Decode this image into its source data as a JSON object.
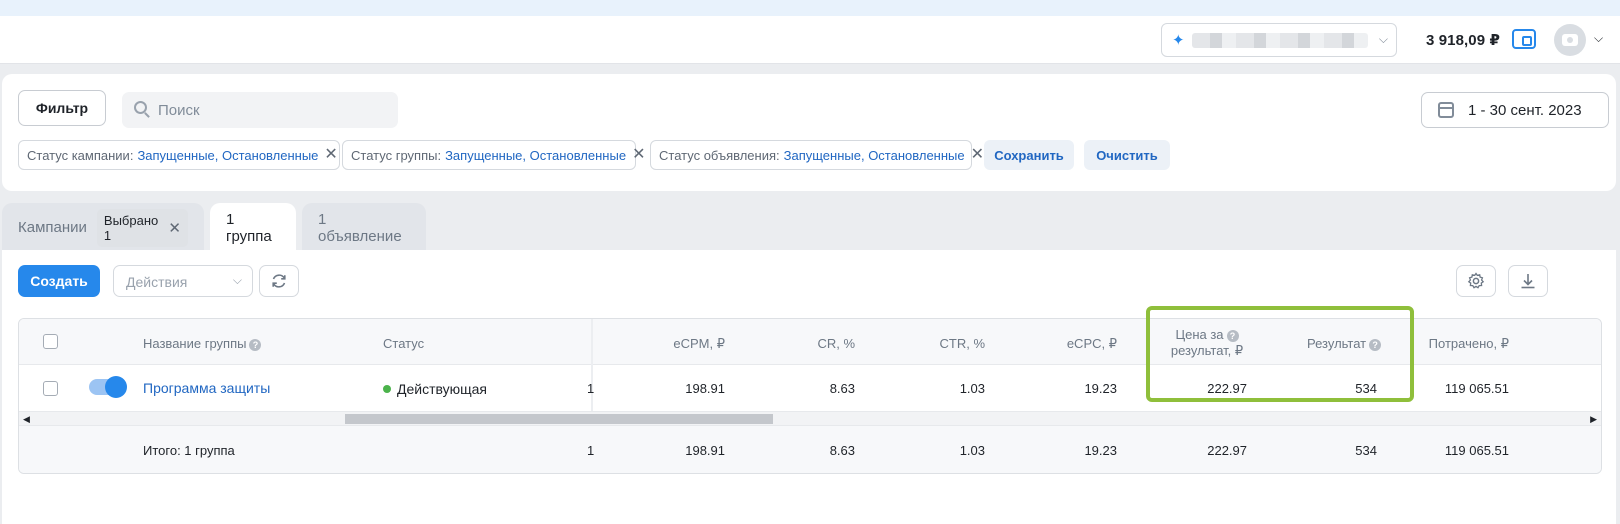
{
  "header": {
    "balance": "3 918,09 ₽"
  },
  "filters": {
    "filter_label": "Фильтр",
    "search_placeholder": "Поиск",
    "date_range": "1 - 30 сент. 2023",
    "chips": [
      {
        "key": "Статус кампании:",
        "value": "Запущенные, Остановленные"
      },
      {
        "key": "Статус группы:",
        "value": "Запущенные, Остановленные"
      },
      {
        "key": "Статус объявления:",
        "value": "Запущенные, Остановленные"
      }
    ],
    "save_label": "Сохранить",
    "clear_label": "Очистить"
  },
  "tabs": {
    "campaigns": "Кампании",
    "selected_badge": "Выбрано 1",
    "groups": "1 группа",
    "ads": "1 объявление"
  },
  "toolbar": {
    "create_label": "Создать",
    "actions_label": "Действия"
  },
  "table": {
    "columns": {
      "name": "Название группы",
      "status": "Статус",
      "ecpm": "eCPM, ₽",
      "cr": "CR, %",
      "ctr": "CTR, %",
      "ecpc": "eCPC, ₽",
      "price_per_result_1": "Цена за",
      "price_per_result_2": "результат, ₽",
      "result": "Результат",
      "spent": "Потрачено, ₽"
    },
    "row": {
      "name": "Программа защиты",
      "status": "Действующая",
      "partial": "1",
      "ecpm": "198.91",
      "cr": "8.63",
      "ctr": "1.03",
      "ecpc": "19.23",
      "price_per_result": "222.97",
      "result": "534",
      "spent": "119 065.51"
    },
    "total": {
      "label": "Итого: 1 группа",
      "partial": "1",
      "ecpm": "198.91",
      "cr": "8.63",
      "ctr": "1.03",
      "ecpc": "19.23",
      "price_per_result": "222.97",
      "result": "534",
      "spent": "119 065.51"
    }
  },
  "colors": {
    "accent": "#2688eb",
    "highlight": "#8fbf3b",
    "status_active": "#4bb34b"
  }
}
